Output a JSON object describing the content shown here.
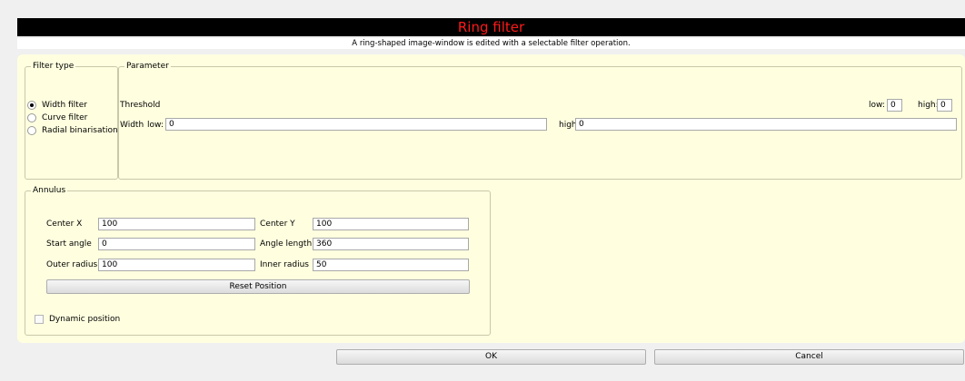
{
  "window": {
    "title": "Ring filter",
    "subtitle": "A ring-shaped image-window is edited with a selectable filter operation."
  },
  "filter_type": {
    "legend": "Filter type",
    "options": [
      {
        "label": "Width filter",
        "checked": true
      },
      {
        "label": "Curve filter",
        "checked": false
      },
      {
        "label": "Radial binarisation",
        "checked": false
      }
    ]
  },
  "parameter": {
    "legend": "Parameter",
    "threshold_label": "Threshold",
    "threshold_low_label": "low:",
    "threshold_low_value": "0",
    "threshold_high_label": "high:",
    "threshold_high_value": "0",
    "width_label": "Width",
    "width_low_label": "low:",
    "width_low_value": "0",
    "width_high_label": "high:",
    "width_high_value": "0"
  },
  "annulus": {
    "legend": "Annulus",
    "center_x_label": "Center X",
    "center_x_value": "100",
    "center_y_label": "Center Y",
    "center_y_value": "100",
    "start_angle_label": "Start angle",
    "start_angle_value": "0",
    "angle_length_label": "Angle length",
    "angle_length_value": "360",
    "outer_radius_label": "Outer radius",
    "outer_radius_value": "100",
    "inner_radius_label": "Inner radius",
    "inner_radius_value": "50",
    "reset_label": "Reset Position",
    "dynamic_label": "Dynamic position",
    "dynamic_checked": false
  },
  "buttons": {
    "ok": "OK",
    "cancel": "Cancel"
  }
}
